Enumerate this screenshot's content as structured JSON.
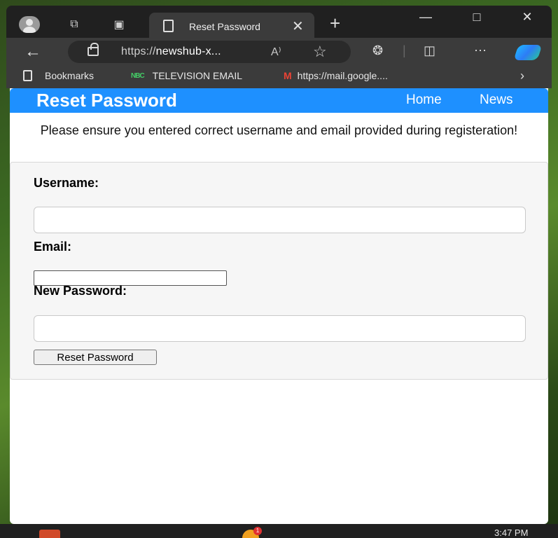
{
  "browser": {
    "tab_title": "Reset Password",
    "url_host": "https://",
    "url_rest": "newshub-x...",
    "read_aloud_glyph": "A⁾",
    "bookmarks": [
      {
        "label": "Bookmarks"
      },
      {
        "logo": "NBC",
        "label": "TELEVISION EMAIL"
      },
      {
        "logo": "M",
        "label": "https://mail.google...."
      }
    ]
  },
  "page": {
    "header_title": "Reset Password",
    "nav": [
      {
        "label": "Home"
      },
      {
        "label": "News"
      }
    ],
    "notice": "Please ensure you entered correct username and email provided during registeration!",
    "form": {
      "username_label": "Username:",
      "username_value": "",
      "email_label": "Email:",
      "email_value": "",
      "new_password_label": "New Password:",
      "new_password_value": "",
      "submit_label": "Reset Password"
    }
  },
  "taskbar": {
    "badge_count": "1",
    "time": "3:47 PM"
  },
  "colors": {
    "header_bg": "#1e90ff",
    "chrome_dark": "#202020",
    "chrome_mid": "#3b3b3b"
  }
}
